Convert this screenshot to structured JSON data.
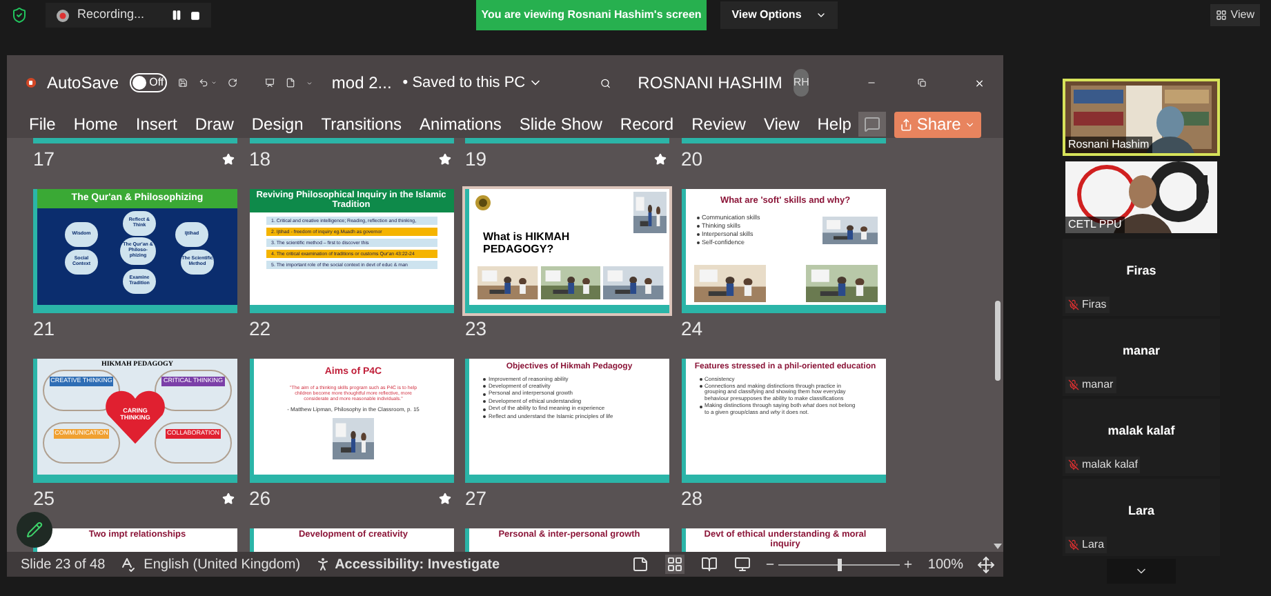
{
  "zoom_bar": {
    "recording": "Recording...",
    "banner": "You are viewing Rosnani Hashim's screen",
    "view_options": "View Options",
    "view": "View"
  },
  "ppt": {
    "autosave": "AutoSave",
    "autosave_state": "Off",
    "autosave_on": false,
    "filename": "mod 2...",
    "saved": "• Saved to this PC",
    "user": "ROSNANI HASHIM",
    "initials": "RH",
    "share": "Share",
    "menu": [
      "File",
      "Home",
      "Insert",
      "Draw",
      "Design",
      "Transitions",
      "Animations",
      "Slide Show",
      "Record",
      "Review",
      "View",
      "Help"
    ]
  },
  "slides": [
    {
      "number": "17",
      "kind": "footer",
      "selected": false,
      "transition": true
    },
    {
      "number": "18",
      "kind": "footer",
      "selected": false,
      "transition": true
    },
    {
      "number": "19",
      "kind": "footer",
      "selected": false,
      "transition": true
    },
    {
      "number": "20",
      "kind": "footer",
      "selected": false,
      "transition": false
    },
    {
      "number": "21",
      "kind": "circles",
      "selected": false,
      "transition": false,
      "title": "The Qur'an & Philosophizing",
      "center": "The Qur'an & Philoso-phizing",
      "nodes": [
        "Reflect & Think",
        "Wisdom",
        "Ijtihad",
        "Social Context",
        "The Scientific Method",
        "Examine Tradition"
      ]
    },
    {
      "number": "22",
      "kind": "steps",
      "selected": false,
      "transition": false,
      "title": "Reviving Philosophical Inquiry in the Islamic Tradition",
      "steps": [
        {
          "text": "1. Critical and creative intelligence; Reading, reflection and thinking,",
          "highlight": false
        },
        {
          "text": "2. Ijtihad - freedom of inquiry eg.Muadh as governor",
          "highlight": true
        },
        {
          "text": "3. The scientific method – first to discover this",
          "highlight": false
        },
        {
          "text": "4. The critical examination of traditions or customs Qur'an 43:22-24",
          "highlight": true
        },
        {
          "text": "5. The important role of the social context in devt of educ & man",
          "highlight": false
        }
      ]
    },
    {
      "number": "23",
      "kind": "cover",
      "selected": true,
      "transition": false,
      "title": "What is HIKMAH PEDAGOGY?"
    },
    {
      "number": "24",
      "kind": "bullets_photos",
      "selected": false,
      "transition": false,
      "title": "What are 'soft' skills and why?",
      "bullets": [
        "Communication skills",
        "Thinking skills",
        "Interpersonal skills",
        "Self-confidence"
      ]
    },
    {
      "number": "25",
      "kind": "quadrants",
      "selected": false,
      "transition": true,
      "title": "HIKMAH PEDAGOGY",
      "center": "CARING THINKING",
      "quadrants": [
        {
          "label": "CREATIVE THINKING",
          "color": "#2e6db5"
        },
        {
          "label": "CRITICAL THINKING",
          "color": "#7b3fa8"
        },
        {
          "label": "COMMUNICATION",
          "color": "#f0a030"
        },
        {
          "label": "COLLABORATION",
          "color": "#e02030"
        }
      ]
    },
    {
      "number": "26",
      "kind": "quote",
      "selected": false,
      "transition": true,
      "title": "Aims of P4C",
      "quote": "\"The aim of a thinking skills program such as P4C is to help children become more thoughtful more reflective, more considerate and more reasonable individuals.\"",
      "attribution": "- Matthew Lipman, Philosophy in the Classroom, p. 15"
    },
    {
      "number": "27",
      "kind": "bullets",
      "selected": false,
      "transition": false,
      "title": "Objectives of Hikmah Pedagogy",
      "bullets": [
        "Improvement of reasoning ability",
        "Development of creativity",
        "Personal and interpersonal growth",
        "Development of ethical understanding",
        "Devt of the ability to find meaning in experience",
        "Reflect and understand the Islamic principles of life"
      ]
    },
    {
      "number": "28",
      "kind": "bullets",
      "selected": false,
      "transition": false,
      "title": "Features stressed in a phil-oriented education",
      "bullets": [
        "Consistency",
        "Connections and making distinctions through practice in grouping and classifying and showing them how everyday behaviour presupposes the ability to make classifications",
        "Making distinctions through saying both *what* does not belong to a given group/class and *why* it does not."
      ]
    },
    {
      "kind": "title_only",
      "selected": false,
      "title": "Two impt relationships"
    },
    {
      "kind": "title_only",
      "selected": false,
      "title": "Development of creativity"
    },
    {
      "kind": "title_only",
      "selected": false,
      "title": "Personal & inter-personal growth"
    },
    {
      "kind": "title_only",
      "selected": false,
      "title": "Devt of ethical understanding & moral inquiry"
    }
  ],
  "status": {
    "slide": "Slide 23 of 48",
    "language": "English (United Kingdom)",
    "accessibility": "Accessibility: Investigate",
    "zoom": "100%",
    "level": 0.5
  },
  "participants": [
    {
      "name": "Rosnani Hashim",
      "kind": "video",
      "active": true
    },
    {
      "name": "CETL PPU",
      "kind": "video",
      "active": false
    },
    {
      "name": "Firas",
      "label": "Firas",
      "kind": "name",
      "active": false,
      "muted": true
    },
    {
      "name": "manar",
      "label": "manar",
      "kind": "name",
      "active": false,
      "muted": true
    },
    {
      "name": "malak kalaf",
      "label": "malak kalaf",
      "kind": "name",
      "active": false,
      "muted": true
    },
    {
      "name": "Lara",
      "label": "Lara",
      "kind": "name",
      "active": false,
      "muted": true
    }
  ]
}
